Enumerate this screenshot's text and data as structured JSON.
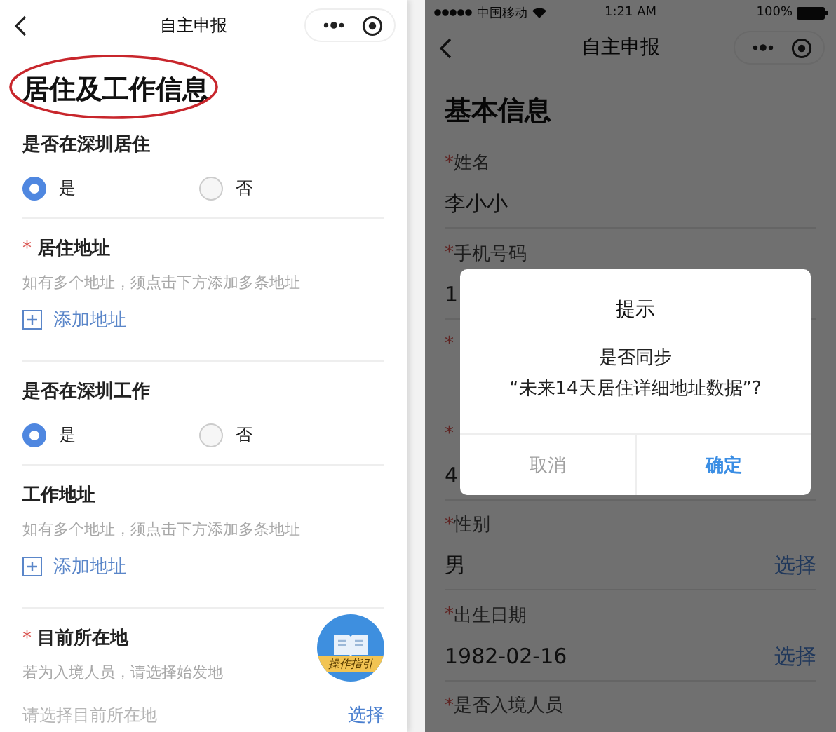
{
  "left_screen": {
    "nav": {
      "title": "自主申报"
    },
    "page_title": "居住及工作信息",
    "sections": [
      {
        "kind": "radio",
        "label": "是否在深圳居住",
        "options": [
          {
            "label": "是",
            "selected": true
          },
          {
            "label": "否",
            "selected": false
          }
        ]
      },
      {
        "kind": "address",
        "required_mark": "*",
        "label": "居住地址",
        "hint": "如有多个地址，须点击下方添加多条地址",
        "add_label": "添加地址"
      },
      {
        "kind": "radio",
        "label": "是否在深圳工作",
        "options": [
          {
            "label": "是",
            "selected": true
          },
          {
            "label": "否",
            "selected": false
          }
        ]
      },
      {
        "kind": "address",
        "label": "工作地址",
        "hint": "如有多个地址，须点击下方添加多条地址",
        "add_label": "添加地址"
      },
      {
        "kind": "picker",
        "required_mark": "*",
        "label": "目前所在地",
        "hint": "若为入境人员，请选择始发地",
        "placeholder": "请选择目前所在地",
        "action": "选择"
      }
    ],
    "guide_button": {
      "label": "操作指引"
    }
  },
  "right_screen": {
    "status_bar": {
      "carrier": "中国移动",
      "time": "1:21 AM",
      "battery": "100%"
    },
    "nav": {
      "title": "自主申报"
    },
    "page_title": "基本信息",
    "fields": [
      {
        "mark": "*",
        "label": "姓名",
        "value": "李小小"
      },
      {
        "mark": "*",
        "label": "手机号码",
        "value": "1"
      },
      {
        "mark": "*"
      },
      {
        "mark": "*",
        "value": "4"
      },
      {
        "mark": "*",
        "label": "性别",
        "value": "男",
        "action": "选择"
      },
      {
        "mark": "*",
        "label": "出生日期",
        "value": "1982-02-16",
        "action": "选择"
      },
      {
        "mark": "*",
        "label": "是否入境人员"
      }
    ],
    "dialog": {
      "title": "提示",
      "message": "是否同步",
      "quote": "“未来14天居住详细地址数据”?",
      "buttons": [
        {
          "label": "取消",
          "kind": "cancel"
        },
        {
          "label": "确定",
          "kind": "confirm"
        }
      ]
    }
  }
}
